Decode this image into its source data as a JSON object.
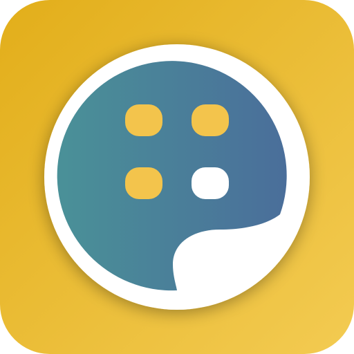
{
  "app_icon": {
    "icon_name": "chat-bubble-dots-app-icon",
    "colors": {
      "background_gradient_start": "#E2AE1A",
      "background_gradient_end": "#F3CB52",
      "bubble_gradient_start": "#4A9198",
      "bubble_gradient_end": "#4A6E9A",
      "ring": "#FFFFFF",
      "dot_yellow": "#F3C44C",
      "dot_white": "#FFFFFF"
    },
    "dots": [
      {
        "name": "dot-top-left",
        "color": "#F3C44C"
      },
      {
        "name": "dot-top-right",
        "color": "#F3C44C"
      },
      {
        "name": "dot-bottom-left",
        "color": "#F3C44C"
      },
      {
        "name": "dot-bottom-right",
        "color": "#FFFFFF"
      }
    ]
  }
}
